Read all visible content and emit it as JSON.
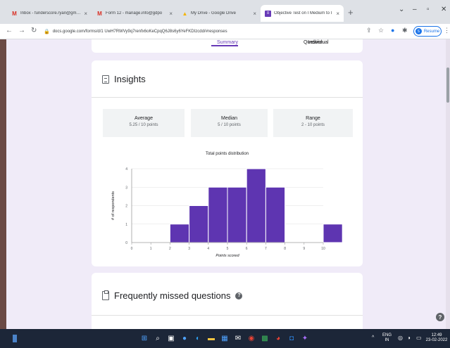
{
  "browser": {
    "tabs": [
      {
        "favicon": "gmail-icon",
        "title": "Inbox - funderscore.ryan@gmail.c"
      },
      {
        "favicon": "gmail-icon",
        "title": "Form 12 - manage.info@gdpo"
      },
      {
        "favicon": "drive-icon",
        "title": "My Drive - Google Drive"
      },
      {
        "favicon": "forms-icon",
        "title": "Objective Test on I Medium to I"
      }
    ],
    "url": "docs.google.com/forms/d/1 UwH7RWVy9q7renfx6oKeCpqQ6J8s6y6YeFKDIzcdd/#responses",
    "resume_label": "Resume"
  },
  "form_tabs": {
    "summary": "Summary",
    "question": "Question",
    "individual": "Individual"
  },
  "insights": {
    "title": "Insights",
    "stats": [
      {
        "label": "Average",
        "value": "5.25 / 10 points"
      },
      {
        "label": "Median",
        "value": "5 / 10 points"
      },
      {
        "label": "Range",
        "value": "2 - 10 points"
      }
    ]
  },
  "chart_data": {
    "type": "bar",
    "title": "Total points distribution",
    "xlabel": "Points scored",
    "ylabel": "# of respondents",
    "x": [
      0,
      1,
      2,
      3,
      4,
      5,
      6,
      7,
      8,
      9,
      10
    ],
    "values": [
      0,
      0,
      1,
      2,
      3,
      3,
      4,
      3,
      0,
      0,
      1
    ],
    "ylim": [
      0,
      4
    ],
    "yticks": [
      0,
      1,
      2,
      3,
      4
    ],
    "grid": true,
    "bar_color": "#5e35b1"
  },
  "missed": {
    "title": "Frequently missed questions"
  },
  "taskbar": {
    "lang": "ENG",
    "region": "IN",
    "time": "12:49",
    "date": "23-02-2022"
  },
  "colors": {
    "accent": "#673ab7",
    "page_bg": "#f0ebf8",
    "taskbar_bg": "#1c2638"
  }
}
